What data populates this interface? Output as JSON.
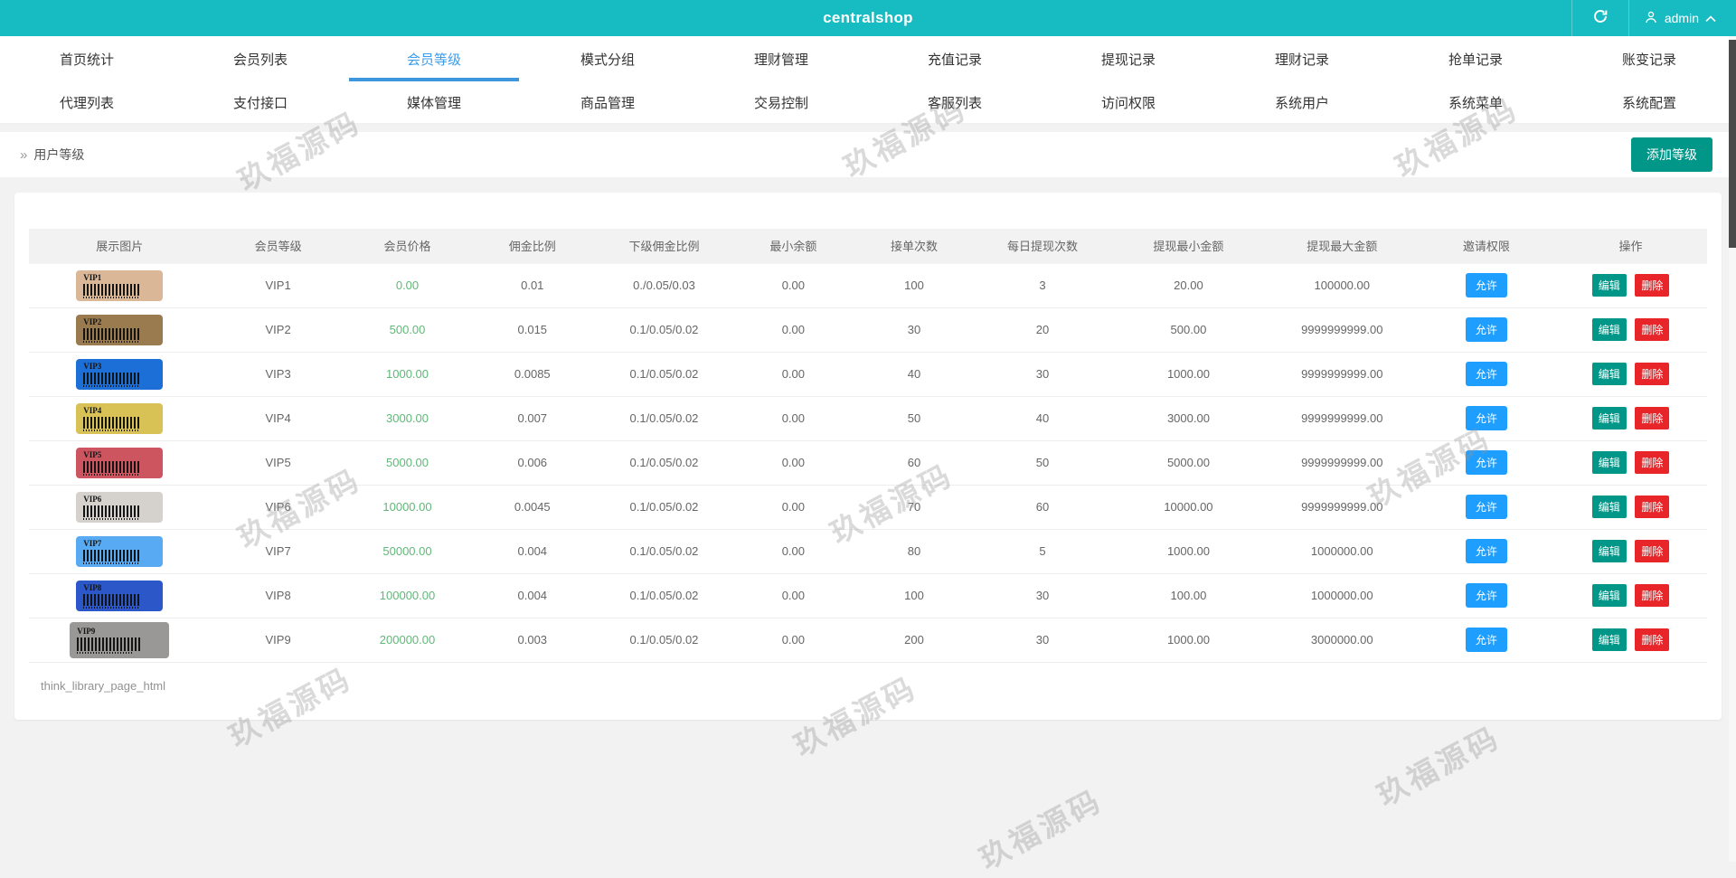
{
  "header": {
    "title": "centralshop",
    "username": "admin"
  },
  "nav": {
    "active_tab": "会员等级",
    "row1": [
      "首页统计",
      "会员列表",
      "会员等级",
      "模式分组",
      "理财管理",
      "充值记录",
      "提现记录",
      "理财记录",
      "抢单记录",
      "账变记录"
    ],
    "row2": [
      "代理列表",
      "支付接口",
      "媒体管理",
      "商品管理",
      "交易控制",
      "客服列表",
      "访问权限",
      "系统用户",
      "系统菜单",
      "系统配置"
    ]
  },
  "breadcrumb": {
    "marker": "»",
    "label": "用户等级"
  },
  "toolbar": {
    "add_button_label": "添加等级"
  },
  "table": {
    "headers": [
      "展示图片",
      "会员等级",
      "会员价格",
      "佣金比例",
      "下级佣金比例",
      "最小余额",
      "接单次数",
      "每日提现次数",
      "提现最小金额",
      "提现最大金额",
      "邀请权限",
      "操作"
    ],
    "action_labels": {
      "allow": "允许",
      "edit": "编辑",
      "delete": "删除"
    },
    "rows": [
      {
        "image_label": "VIP1",
        "image_color": "#d9b797",
        "level": "VIP1",
        "price": "0.00",
        "commission": "0.01",
        "sub_commission": "0./0.05/0.03",
        "min_balance": "0.00",
        "orders": "100",
        "daily_withdrawals": "3",
        "withdraw_min": "20.00",
        "withdraw_max": "100000.00"
      },
      {
        "image_label": "VIP2",
        "image_color": "#9a7b50",
        "level": "VIP2",
        "price": "500.00",
        "commission": "0.015",
        "sub_commission": "0.1/0.05/0.02",
        "min_balance": "0.00",
        "orders": "30",
        "daily_withdrawals": "20",
        "withdraw_min": "500.00",
        "withdraw_max": "9999999999.00"
      },
      {
        "image_label": "VIP3",
        "image_color": "#1c6fd6",
        "level": "VIP3",
        "price": "1000.00",
        "commission": "0.0085",
        "sub_commission": "0.1/0.05/0.02",
        "min_balance": "0.00",
        "orders": "40",
        "daily_withdrawals": "30",
        "withdraw_min": "1000.00",
        "withdraw_max": "9999999999.00"
      },
      {
        "image_label": "VIP4",
        "image_color": "#d8c255",
        "level": "VIP4",
        "price": "3000.00",
        "commission": "0.007",
        "sub_commission": "0.1/0.05/0.02",
        "min_balance": "0.00",
        "orders": "50",
        "daily_withdrawals": "40",
        "withdraw_min": "3000.00",
        "withdraw_max": "9999999999.00"
      },
      {
        "image_label": "VIP5",
        "image_color": "#cd5560",
        "level": "VIP5",
        "price": "5000.00",
        "commission": "0.006",
        "sub_commission": "0.1/0.05/0.02",
        "min_balance": "0.00",
        "orders": "60",
        "daily_withdrawals": "50",
        "withdraw_min": "5000.00",
        "withdraw_max": "9999999999.00"
      },
      {
        "image_label": "VIP6",
        "image_color": "#d5d2cd",
        "level": "VIP6",
        "price": "10000.00",
        "commission": "0.0045",
        "sub_commission": "0.1/0.05/0.02",
        "min_balance": "0.00",
        "orders": "70",
        "daily_withdrawals": "60",
        "withdraw_min": "10000.00",
        "withdraw_max": "9999999999.00"
      },
      {
        "image_label": "VIP7",
        "image_color": "#58aaf2",
        "level": "VIP7",
        "price": "50000.00",
        "commission": "0.004",
        "sub_commission": "0.1/0.05/0.02",
        "min_balance": "0.00",
        "orders": "80",
        "daily_withdrawals": "5",
        "withdraw_min": "1000.00",
        "withdraw_max": "1000000.00"
      },
      {
        "image_label": "VIP8",
        "image_color": "#2b57c9",
        "level": "VIP8",
        "price": "100000.00",
        "commission": "0.004",
        "sub_commission": "0.1/0.05/0.02",
        "min_balance": "0.00",
        "orders": "100",
        "daily_withdrawals": "30",
        "withdraw_min": "100.00",
        "withdraw_max": "1000000.00"
      },
      {
        "image_label": "VIP9",
        "image_color": "#9a9896",
        "level": "VIP9",
        "price": "200000.00",
        "commission": "0.003",
        "sub_commission": "0.1/0.05/0.02",
        "min_balance": "0.00",
        "orders": "200",
        "daily_withdrawals": "30",
        "withdraw_min": "1000.00",
        "withdraw_max": "3000000.00"
      }
    ]
  },
  "footer": {
    "note": "think_library_page_html"
  },
  "watermark": {
    "text": "玖福源码"
  },
  "colors": {
    "header_bg": "#17bcc3",
    "active_tab_text": "#3e9ce9",
    "active_tab_underline": "#3e97dd",
    "price_green": "#5FB878",
    "allow_button": "#1E9FFF",
    "edit_button": "#009688",
    "delete_button": "#e8262a",
    "add_button": "#009688",
    "page_bg": "#f2f2f2"
  }
}
